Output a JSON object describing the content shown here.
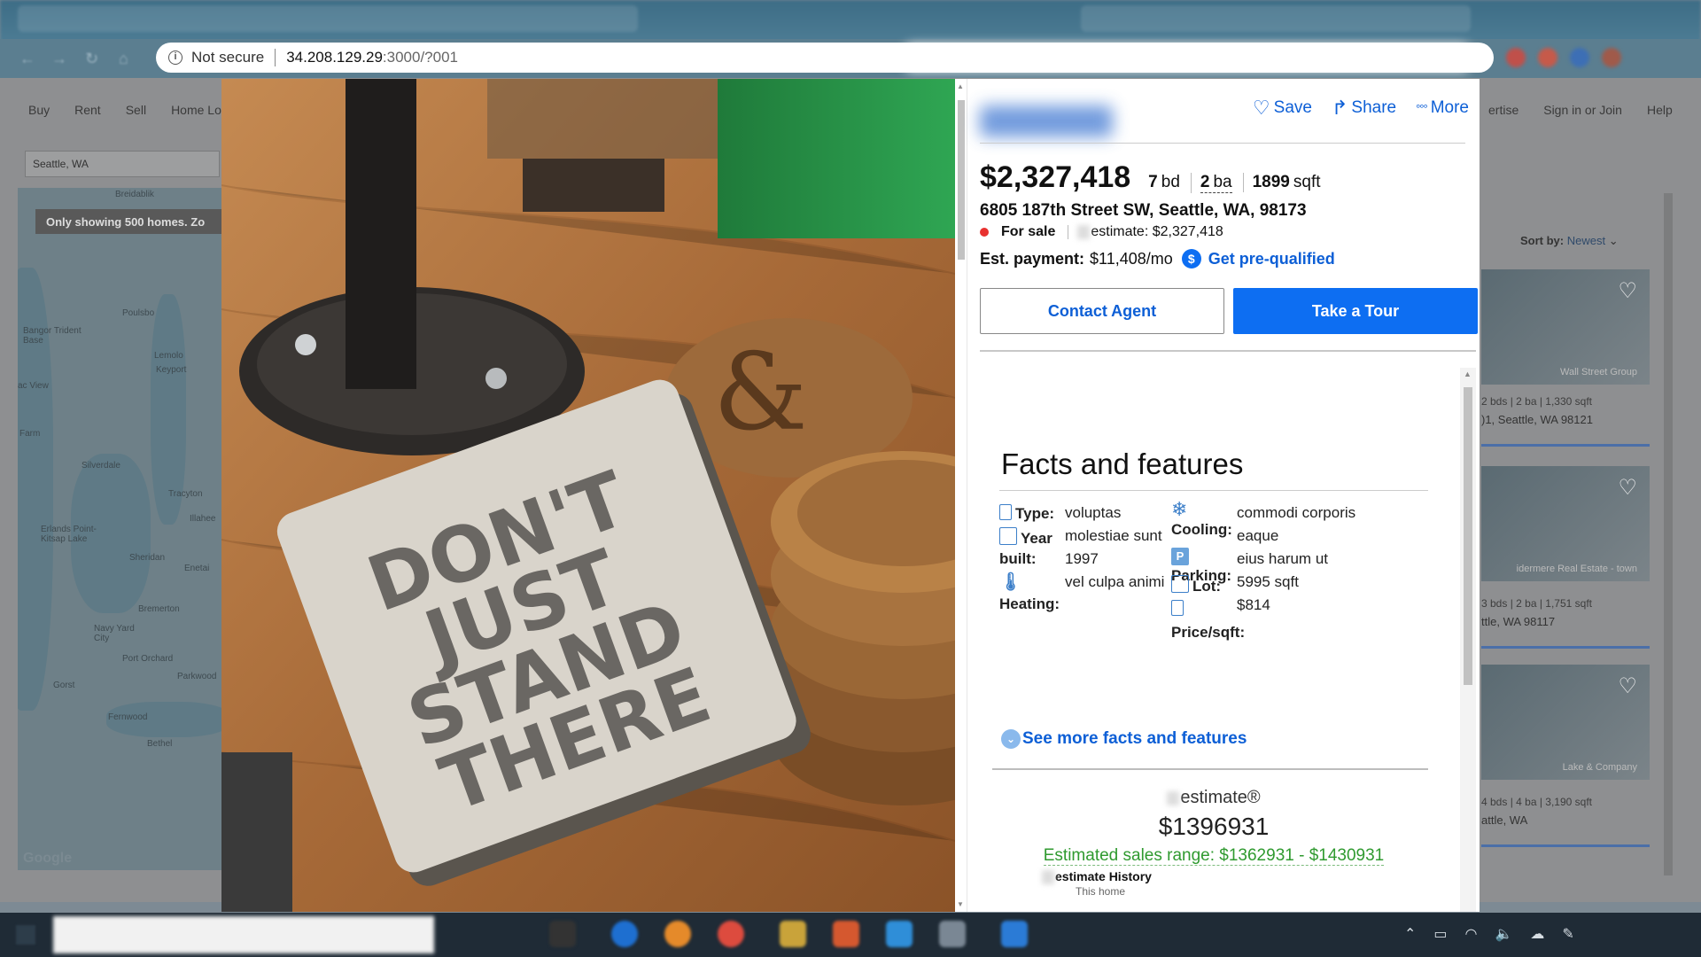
{
  "browser": {
    "security_label": "Not secure",
    "url_host": "34.208.129.29",
    "url_path": ":3000/?001"
  },
  "background_page": {
    "nav_left": [
      "Buy",
      "Rent",
      "Sell",
      "Home Lo"
    ],
    "nav_right": [
      "ertise",
      "Sign in or Join",
      "Help"
    ],
    "search_value": "Seattle, WA",
    "map_banner": "Only showing 500 homes. Zo",
    "map_towns": [
      "Breidablik",
      "Poulsbo",
      "Bangor Trident Base",
      "Lemolo",
      "Keyport",
      "ac View",
      "Farm",
      "Silverdale",
      "Erlands Point-Kitsap Lake",
      "Tracyton",
      "Illahee",
      "Sheridan",
      "Enetai",
      "Bremerton",
      "Navy Yard City",
      "Port Orchard",
      "Gorst",
      "Parkwood",
      "Fernwood",
      "Bethel"
    ],
    "map_attribution": "Google",
    "sort_label": "Sort by:",
    "sort_value": "Newest",
    "listings": [
      {
        "brand": "Wall Street Group",
        "meta": "2 bds | 2 ba | 1,330 sqft",
        "address": ")1, Seattle, WA 98121"
      },
      {
        "brand": "idermere Real Estate - town",
        "meta": "3 bds | 2 ba | 1,751 sqft",
        "address": "ttle, WA 98117"
      },
      {
        "brand": "Lake & Company",
        "meta": "4 bds | 4 ba | 3,190 sqft",
        "address": "attle, WA"
      }
    ]
  },
  "listing": {
    "actions": {
      "save": "Save",
      "share": "Share",
      "more": "More"
    },
    "price": "$2,327,418",
    "beds_value": "7",
    "beds_unit": "bd",
    "baths_value": "2",
    "baths_unit": "ba",
    "sqft_value": "1899",
    "sqft_unit": "sqft",
    "address": "6805 187th Street SW, Seattle, WA, 98173",
    "status": "For sale",
    "estimate_text": "estimate: $2,327,418",
    "payment_label": "Est. payment:",
    "payment_value": "$11,408/mo",
    "prequal_link": "Get pre-qualified",
    "contact_button": "Contact Agent",
    "tour_button": "Take a Tour",
    "status_color": "#e8312f",
    "accent_color": "#0d6ef2"
  },
  "facts": {
    "title": "Facts and features",
    "type_label": "Type:",
    "type_value": "voluptas",
    "year_label": "Year built:",
    "year_value_1": "molestiae sunt",
    "year_value_2": "1997",
    "heating_label": "Heating:",
    "heating_value": "vel culpa animi",
    "cooling_label": "Cooling:",
    "cooling_value_1": "commodi corporis",
    "cooling_value_2": "eaque",
    "parking_label": "Parking:",
    "parking_value": "eius harum ut",
    "lot_label": "Lot:",
    "lot_value": "5995 sqft",
    "pricesqft_label": "Price/sqft:",
    "pricesqft_value": "$814",
    "see_more": "See more facts and features"
  },
  "estimate": {
    "label": "estimate®",
    "value": "$1396931",
    "range": "Estimated sales range: $1362931 - $1430931",
    "history_title": "estimate History",
    "history_sub": "This home"
  },
  "photo": {
    "notebook_text": [
      "DON'T",
      "JUST",
      "STAND",
      "THERE"
    ]
  }
}
